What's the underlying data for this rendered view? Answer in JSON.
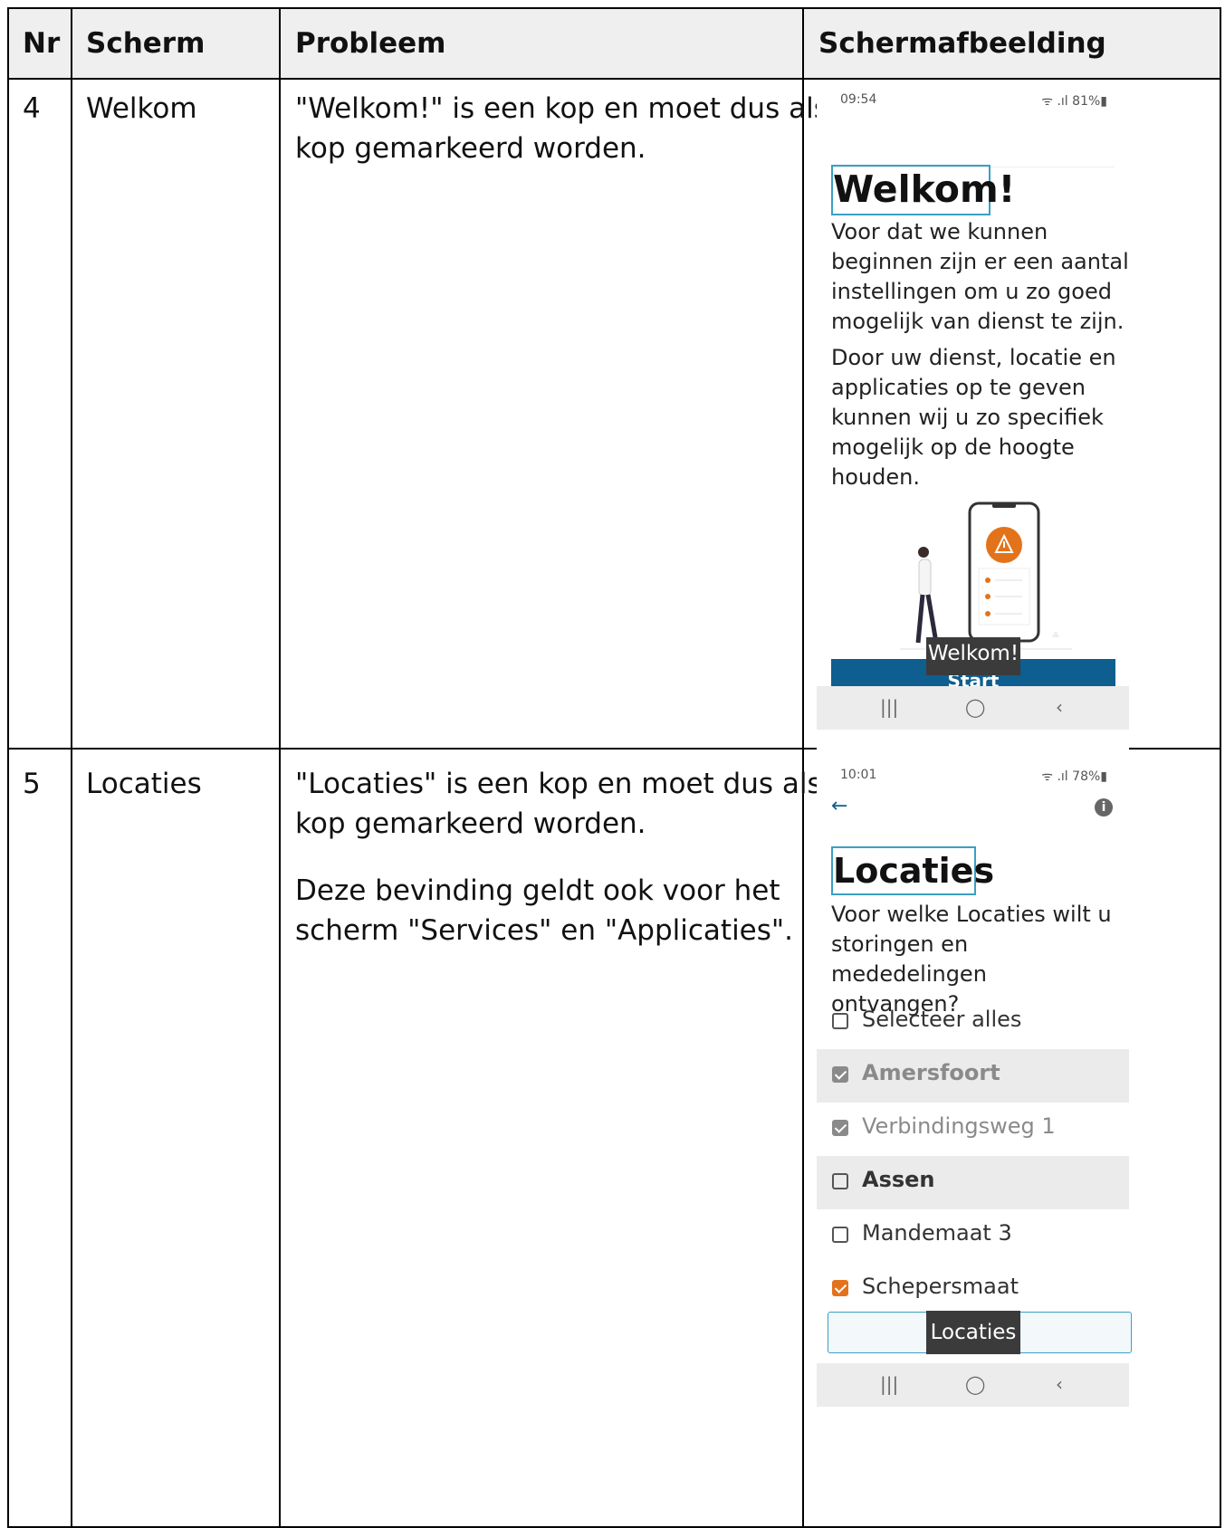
{
  "table": {
    "headers": {
      "nr": "Nr",
      "scherm": "Scherm",
      "probleem": "Probleem",
      "schermafbeelding": "Schermafbeelding"
    },
    "rows": [
      {
        "nr": "4",
        "scherm": "Welkom",
        "probleem": [
          "\"Welkom!\" is een kop en moet dus als",
          "kop gemarkeerd worden."
        ],
        "screenshot": {
          "time": "09:54",
          "signal": "81%",
          "heading": "Welkom!",
          "para1": [
            "Voor dat we kunnen",
            "beginnen zijn er een aantal",
            "instellingen om u zo goed",
            "mogelijk van dienst te zijn."
          ],
          "para2": [
            "Door uw dienst, locatie en",
            "applicaties op te geven",
            "kunnen wij u zo specifiek",
            "mogelijk op de hoogte",
            "houden."
          ],
          "button": "Start",
          "tooltip": "Welkom!"
        }
      },
      {
        "nr": "5",
        "scherm": "Locaties",
        "probleem": [
          "\"Locaties\" is een kop en moet dus als",
          "kop gemarkeerd worden."
        ],
        "probleem2": [
          "Deze bevinding geldt ook voor het",
          "scherm \"Services\" en \"Applicaties\"."
        ],
        "screenshot": {
          "time": "10:01",
          "signal": "78%",
          "heading": "Locaties",
          "para": [
            "Voor welke Locaties wilt u",
            "storingen en mededelingen",
            "ontvangen?"
          ],
          "items": [
            {
              "label": "Selecteer alles",
              "state": "unchecked"
            },
            {
              "label": "Amersfoort",
              "state": "checked"
            },
            {
              "label": "Verbindingsweg 1",
              "state": "checked"
            },
            {
              "label": "Assen",
              "state": "unchecked"
            },
            {
              "label": "Mandemaat 3",
              "state": "unchecked"
            },
            {
              "label": "Schepersmaat",
              "state": "checked"
            }
          ],
          "tooltip": "Locaties"
        }
      }
    ]
  },
  "colors": {
    "accent_orange": "#e3731b",
    "button_blue": "#0e5e8f",
    "focus_outline": "#3aa0c4",
    "tooltip": "#3b3b3b"
  }
}
